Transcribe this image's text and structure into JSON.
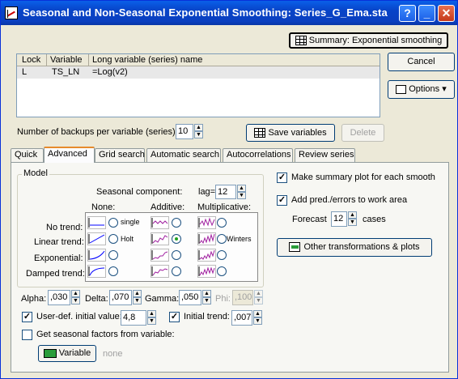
{
  "window": {
    "title": "Seasonal and Non-Seasonal Exponential Smoothing: Series_G_Ema.sta",
    "help_glyph": "?",
    "minimize_glyph": "_",
    "close_glyph": "✕"
  },
  "buttons": {
    "summary": "Summary:  Exponential smoothing",
    "cancel": "Cancel",
    "options": "Options",
    "save_variables": "Save variables",
    "delete": "Delete",
    "other_transformations": "Other transformations & plots",
    "variable": "Variable"
  },
  "variable_list": {
    "columns": [
      "Lock",
      "Variable",
      "Long variable (series) name"
    ],
    "rows": [
      {
        "lock": "L",
        "variable": "TS_LN",
        "long_name": "=Log(v2)"
      }
    ]
  },
  "backups": {
    "label": "Number of backups per variable (series):",
    "value": "10"
  },
  "tabs": [
    {
      "label": "Quick",
      "active": false
    },
    {
      "label": "Advanced",
      "active": true
    },
    {
      "label": "Grid search",
      "active": false
    },
    {
      "label": "Automatic search",
      "active": false
    },
    {
      "label": "Autocorrelations",
      "active": false
    },
    {
      "label": "Review series",
      "active": false
    }
  ],
  "model": {
    "legend": "Model",
    "seasonal_component_label": "Seasonal component:",
    "lag_label": "lag=",
    "lag_value": "12",
    "col_none": "None:",
    "col_additive": "Additive:",
    "col_multiplicative": "Multiplicative:",
    "rows": [
      "No trend:",
      "Linear trend:",
      "Exponential:",
      "Damped trend:"
    ],
    "single_label": "single",
    "holt_label": "Holt",
    "winters_label": "Winters",
    "selected": "Linear trend / Additive"
  },
  "params": {
    "alpha_label": "Alpha:",
    "alpha": ",030",
    "delta_label": "Delta:",
    "delta": ",070",
    "gamma_label": "Gamma:",
    "gamma": ",050",
    "phi_label": "Phi:",
    "phi": ",100"
  },
  "initial": {
    "user_def_label": "User-def. initial value:",
    "user_def_checked": true,
    "user_def_value": "4,8",
    "initial_trend_label": "Initial trend:",
    "initial_trend_checked": true,
    "initial_trend_value": ",007"
  },
  "seasonal_factors": {
    "label": "Get seasonal factors from variable:",
    "checked": false,
    "variable_value": "none"
  },
  "right": {
    "summary_plot_label": "Make summary plot for each smooth",
    "summary_plot_checked": true,
    "add_pred_label": "Add pred./errors to work area",
    "add_pred_checked": true,
    "forecast_label": "Forecast",
    "forecast_value": "12",
    "cases_label": "cases"
  },
  "colors": {
    "titlebar": "#0a4bd6",
    "accent_tab": "#e68b2c",
    "plot_line": "#a020a0"
  }
}
